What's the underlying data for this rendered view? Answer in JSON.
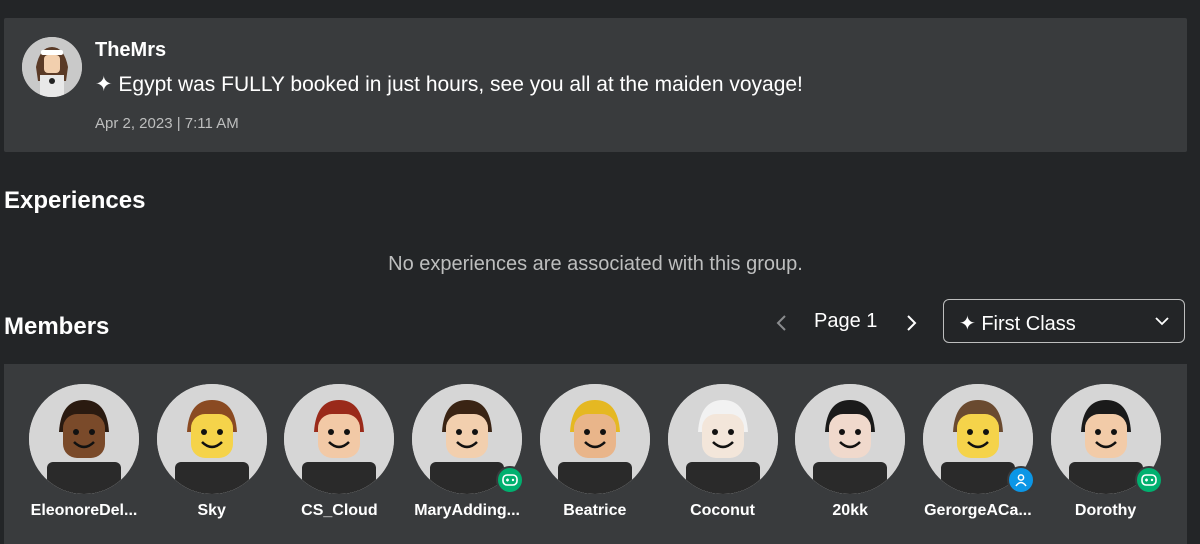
{
  "shout": {
    "poster": "TheMrs",
    "message": "✦ Egypt was FULLY booked in just hours, see you all at the maiden voyage!",
    "date": "Apr 2, 2023 | 7:11 AM"
  },
  "experiences": {
    "title": "Experiences",
    "empty_message": "No experiences are associated with this group."
  },
  "members": {
    "title": "Members",
    "pager": {
      "label": "Page 1"
    },
    "role_select": {
      "selected": "✦ First Class"
    },
    "list": [
      {
        "name": "EleonoreDel...",
        "badge": "",
        "skin": "#7a4a2a",
        "hair": "#2a1a10"
      },
      {
        "name": "Sky",
        "badge": "",
        "skin": "#f5d34a",
        "hair": "#8a4a22"
      },
      {
        "name": "CS_Cloud",
        "badge": "",
        "skin": "#f2c9a6",
        "hair": "#9a2a1a"
      },
      {
        "name": "MaryAdding...",
        "badge": "game",
        "skin": "#f2cfae",
        "hair": "#3a2414"
      },
      {
        "name": "Beatrice",
        "badge": "",
        "skin": "#e9b58a",
        "hair": "#e5b822"
      },
      {
        "name": "Coconut",
        "badge": "",
        "skin": "#f3e6da",
        "hair": "#f2f2f2"
      },
      {
        "name": "20kk",
        "badge": "",
        "skin": "#f0d9cc",
        "hair": "#1a1a1a"
      },
      {
        "name": "GerorgeACa...",
        "badge": "studio",
        "skin": "#f5d34a",
        "hair": "#6a4a30"
      },
      {
        "name": "Dorothy",
        "badge": "game",
        "skin": "#f2cba8",
        "hair": "#1a1a1a"
      }
    ]
  },
  "colors": {
    "background": "#232527",
    "panel": "#393b3d",
    "muted_text": "#bdbebe",
    "game_badge": "#00b06f",
    "studio_badge": "#0b96e6"
  }
}
